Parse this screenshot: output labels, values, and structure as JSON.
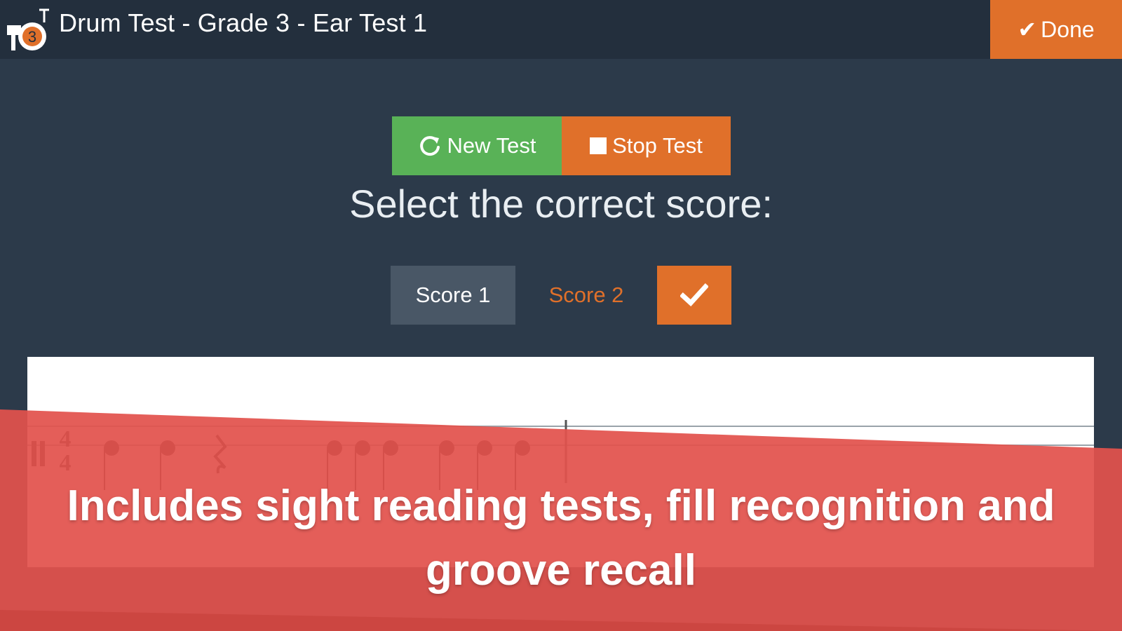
{
  "header": {
    "title": "Drum Test - Grade 3 -  Ear Test 1",
    "logo_badge": "3",
    "done_label": "Done"
  },
  "controls": {
    "new_test_label": "New Test",
    "stop_test_label": "Stop Test"
  },
  "prompt": "Select the correct score:",
  "scores": {
    "score1_label": "Score 1",
    "score2_label": "Score 2",
    "selected": "Score 2"
  },
  "notation": {
    "time_signature_top": "4",
    "time_signature_bottom": "4"
  },
  "banner": {
    "text": "Includes sight reading tests, fill recognition and groove recall"
  },
  "colors": {
    "header_bg": "#232f3d",
    "page_bg": "#2c3a4a",
    "accent_orange": "#e0702a",
    "accent_green": "#59b257",
    "banner_red": "#e2524c"
  },
  "icons": {
    "logo": "drum-kit-icon",
    "done": "check-icon",
    "new_test": "refresh-icon",
    "stop_test": "stop-square-icon",
    "confirm": "check-icon"
  }
}
